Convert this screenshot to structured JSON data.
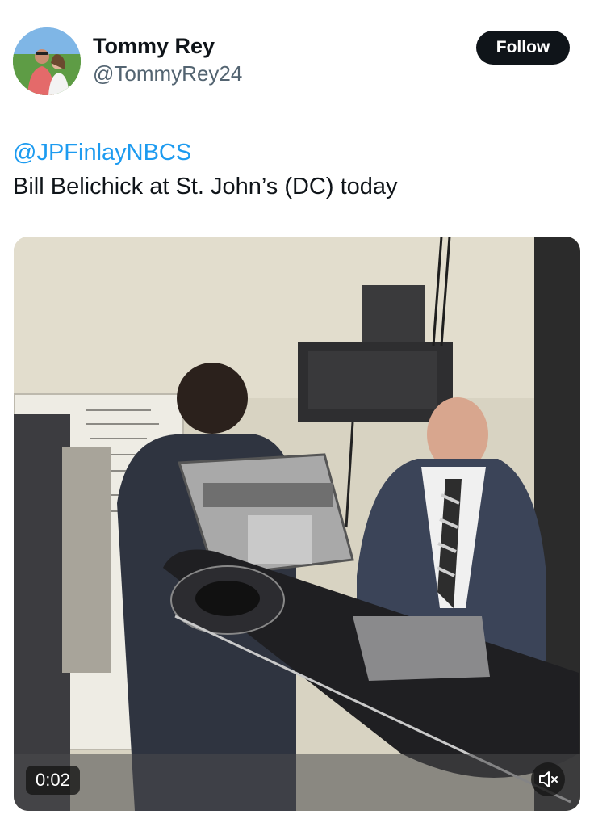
{
  "author": {
    "display_name": "Tommy Rey",
    "handle": "@TommyRey24"
  },
  "follow_button": {
    "label": "Follow"
  },
  "tweet": {
    "mention": "@JPFinlayNBCS",
    "text": "Bill Belichick at St. John’s (DC) today"
  },
  "media": {
    "type": "video",
    "duration": "0:02",
    "muted": true
  },
  "icons": {
    "mute": "speaker-muted-icon"
  },
  "colors": {
    "follow_bg": "#0f1419",
    "link": "#1d9bf0",
    "handle": "#536471"
  }
}
